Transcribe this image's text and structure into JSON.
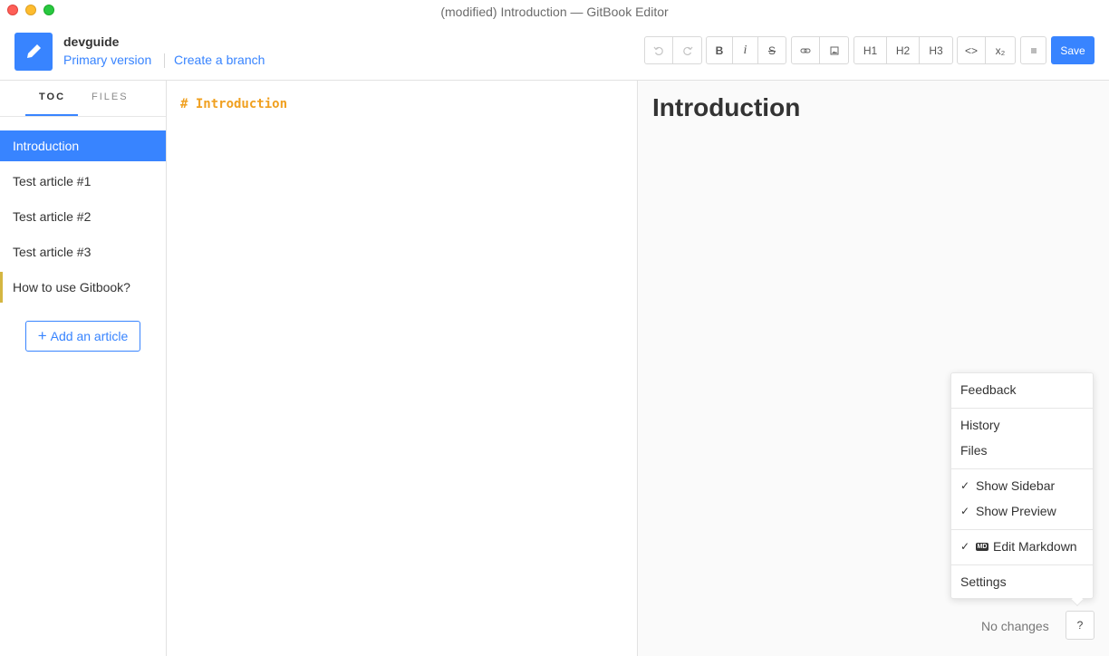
{
  "window": {
    "title": "(modified) Introduction — GitBook Editor"
  },
  "header": {
    "book_name": "devguide",
    "version_label": "Primary version",
    "branch_label": "Create a branch",
    "toolbar": {
      "undo": "undo-icon",
      "redo": "redo-icon",
      "bold": "B",
      "italic": "i",
      "strike": "S",
      "link": "link-icon",
      "image": "image-icon",
      "h1": "H1",
      "h2": "H2",
      "h3": "H3",
      "code": "<>",
      "subscript": "x₂",
      "footnote": "footnote-icon",
      "save_label": "Save"
    },
    "accent_color": "#3884ff"
  },
  "sidebar": {
    "tabs": [
      "TOC",
      "FILES"
    ],
    "active_tab": "TOC",
    "items": [
      {
        "label": "Introduction",
        "active": true
      },
      {
        "label": "Test article #1"
      },
      {
        "label": "Test article #2"
      },
      {
        "label": "Test article #3"
      },
      {
        "label": "How to use Gitbook?",
        "flagged": true
      }
    ],
    "add_article_label": "Add an article"
  },
  "editor": {
    "content": "# Introduction"
  },
  "preview": {
    "heading": "Introduction",
    "status": "No changes",
    "help_label": "?"
  },
  "menu": {
    "feedback": "Feedback",
    "history": "History",
    "files": "Files",
    "show_sidebar": "Show Sidebar",
    "show_preview": "Show Preview",
    "edit_markdown": "Edit Markdown",
    "settings": "Settings",
    "badge": "MD"
  }
}
